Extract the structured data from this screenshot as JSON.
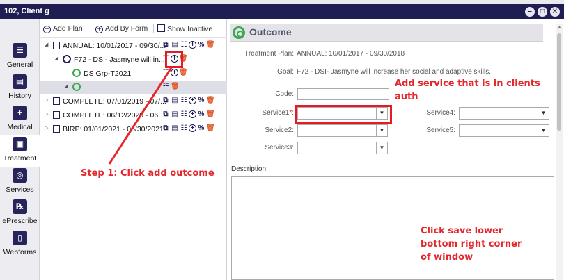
{
  "window": {
    "title": "102, Client g"
  },
  "nav": [
    {
      "label": "General",
      "icon": "user-card-icon"
    },
    {
      "label": "History",
      "icon": "clipboard-icon"
    },
    {
      "label": "Medical",
      "icon": "medical-plus-icon"
    },
    {
      "label": "Treatment",
      "icon": "treatment-icon"
    },
    {
      "label": "Services",
      "icon": "compass-icon"
    },
    {
      "label": "ePrescribe",
      "icon": "rx-icon"
    },
    {
      "label": "Webforms",
      "icon": "document-icon"
    }
  ],
  "toolbar": {
    "add_plan": "Add Plan",
    "add_by_form": "Add By Form",
    "show_inactive": "Show Inactive"
  },
  "tree": [
    {
      "label": "ANNUAL: 10/01/2017 - 09/30/..."
    },
    {
      "label": "F72 - DSI- Jasmyne will in..."
    },
    {
      "label": "DS Grp-T2021"
    },
    {
      "label": ""
    },
    {
      "label": "COMPLETE: 07/01/2019 - 07/..."
    },
    {
      "label": "COMPLETE: 06/12/2020 - 06..."
    },
    {
      "label": "BIRP: 01/01/2021 - 06/30/2021"
    }
  ],
  "panel": {
    "title": "Outcome",
    "treatment_plan_label": "Treatment Plan:",
    "treatment_plan_value": "ANNUAL: 10/01/2017 - 09/30/2018",
    "goal_label": "Goal:",
    "goal_value": "F72 - DSI- Jasmyne will increase her social and adaptive skills.",
    "code_label": "Code:",
    "service1_label": "Service1",
    "service2_label": "Service2:",
    "service3_label": "Service3:",
    "service4_label": "Service4:",
    "service5_label": "Service5:",
    "description_label": "Description:"
  },
  "annotations": {
    "step1": "Step 1: Click add outcome",
    "service_note_line1": "Add service that is in clients",
    "service_note_line2": "auth",
    "save_line1": "Click save lower",
    "save_line2": "bottom right corner",
    "save_line3": "of window",
    "color": "#e5262b"
  },
  "colors": {
    "titlebar": "#1f1d52",
    "accent_green": "#3da84f",
    "delete": "#e05a2a"
  }
}
